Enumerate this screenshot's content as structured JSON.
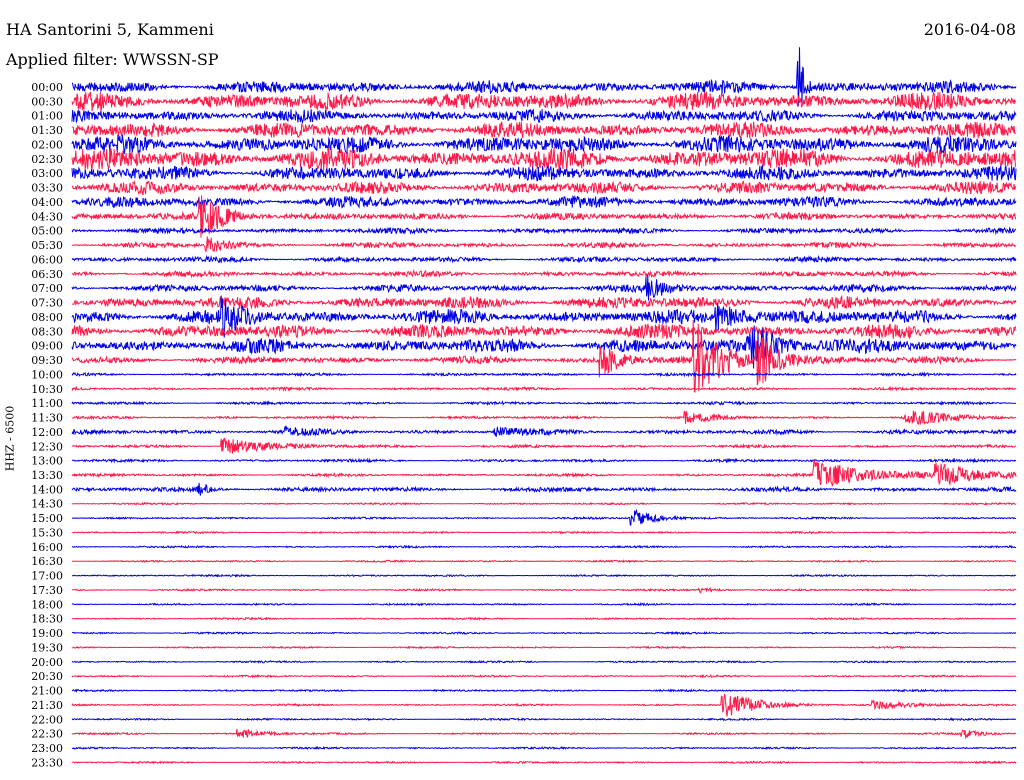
{
  "header": {
    "station": "HA Santorini 5, Kammeni",
    "date": "2016-04-08",
    "filter": "Applied filter: WWSSN-SP",
    "channel": "HHZ - 6500"
  },
  "chart_data": {
    "type": "helicorder",
    "title": "HA Santorini 5, Kammeni",
    "date": "2016-04-08",
    "filter": "WWSSN-SP",
    "channel": "HHZ - 6500",
    "line_minutes": 30,
    "colors": [
      "#0000e6",
      "#ff1a4a"
    ],
    "rows": [
      {
        "label": "00:00",
        "noise": 7
      },
      {
        "label": "00:30",
        "noise": 10
      },
      {
        "label": "01:00",
        "noise": 7
      },
      {
        "label": "01:30",
        "noise": 9
      },
      {
        "label": "02:00",
        "noise": 10
      },
      {
        "label": "02:30",
        "noise": 12
      },
      {
        "label": "03:00",
        "noise": 8
      },
      {
        "label": "03:30",
        "noise": 7
      },
      {
        "label": "04:00",
        "noise": 6
      },
      {
        "label": "04:30",
        "noise": 4
      },
      {
        "label": "05:00",
        "noise": 3
      },
      {
        "label": "05:30",
        "noise": 3
      },
      {
        "label": "06:00",
        "noise": 3
      },
      {
        "label": "06:30",
        "noise": 3
      },
      {
        "label": "07:00",
        "noise": 4
      },
      {
        "label": "07:30",
        "noise": 7
      },
      {
        "label": "08:00",
        "noise": 8
      },
      {
        "label": "08:30",
        "noise": 8
      },
      {
        "label": "09:00",
        "noise": 8
      },
      {
        "label": "09:30",
        "noise": 4
      },
      {
        "label": "10:00",
        "noise": 1.5
      },
      {
        "label": "10:30",
        "noise": 1.5
      },
      {
        "label": "11:00",
        "noise": 1.5
      },
      {
        "label": "11:30",
        "noise": 1.5
      },
      {
        "label": "12:00",
        "noise": 2.5
      },
      {
        "label": "12:30",
        "noise": 1.5
      },
      {
        "label": "13:00",
        "noise": 1.5
      },
      {
        "label": "13:30",
        "noise": 1.5
      },
      {
        "label": "14:00",
        "noise": 2.5
      },
      {
        "label": "14:30",
        "noise": 1
      },
      {
        "label": "15:00",
        "noise": 1
      },
      {
        "label": "15:30",
        "noise": 1
      },
      {
        "label": "16:00",
        "noise": 1
      },
      {
        "label": "16:30",
        "noise": 1
      },
      {
        "label": "17:00",
        "noise": 1
      },
      {
        "label": "17:30",
        "noise": 1
      },
      {
        "label": "18:00",
        "noise": 1
      },
      {
        "label": "18:30",
        "noise": 1
      },
      {
        "label": "19:00",
        "noise": 1
      },
      {
        "label": "19:30",
        "noise": 1
      },
      {
        "label": "20:00",
        "noise": 1
      },
      {
        "label": "20:30",
        "noise": 1
      },
      {
        "label": "21:00",
        "noise": 1
      },
      {
        "label": "21:30",
        "noise": 1
      },
      {
        "label": "22:00",
        "noise": 1
      },
      {
        "label": "22:30",
        "noise": 1
      },
      {
        "label": "23:00",
        "noise": 1
      },
      {
        "label": "23:30",
        "noise": 1
      }
    ],
    "events": [
      {
        "row": 0,
        "minute": 23.1,
        "amplitude": 48,
        "duration_min": 0.3
      },
      {
        "row": 9,
        "minute": 4.1,
        "amplitude": 20,
        "duration_min": 1.5
      },
      {
        "row": 11,
        "minute": 4.3,
        "amplitude": 12,
        "duration_min": 0.7
      },
      {
        "row": 14,
        "minute": 18.3,
        "amplitude": 10,
        "duration_min": 1.2
      },
      {
        "row": 16,
        "minute": 4.8,
        "amplitude": 14,
        "duration_min": 1.2
      },
      {
        "row": 16,
        "minute": 20.5,
        "amplitude": 14,
        "duration_min": 2
      },
      {
        "row": 18,
        "minute": 21.5,
        "amplitude": 24,
        "duration_min": 1.8
      },
      {
        "row": 19,
        "minute": 16.8,
        "amplitude": 18,
        "duration_min": 1.2
      },
      {
        "row": 19,
        "minute": 19.8,
        "amplitude": 40,
        "duration_min": 1.5
      },
      {
        "row": 19,
        "minute": 21.8,
        "amplitude": 28,
        "duration_min": 1.2
      },
      {
        "row": 23,
        "minute": 19.5,
        "amplitude": 6,
        "duration_min": 1.5
      },
      {
        "row": 23,
        "minute": 26.5,
        "amplitude": 8,
        "duration_min": 2.5
      },
      {
        "row": 24,
        "minute": 6.8,
        "amplitude": 4,
        "duration_min": 1.2
      },
      {
        "row": 24,
        "minute": 13.5,
        "amplitude": 4,
        "duration_min": 2
      },
      {
        "row": 25,
        "minute": 4.8,
        "amplitude": 9,
        "duration_min": 2.5
      },
      {
        "row": 27,
        "minute": 23.6,
        "amplitude": 14,
        "duration_min": 3.5
      },
      {
        "row": 27,
        "minute": 27.5,
        "amplitude": 10,
        "duration_min": 2.5
      },
      {
        "row": 28,
        "minute": 4.0,
        "amplitude": 6,
        "duration_min": 0.8
      },
      {
        "row": 30,
        "minute": 17.8,
        "amplitude": 10,
        "duration_min": 1.3
      },
      {
        "row": 35,
        "minute": 20.0,
        "amplitude": 3,
        "duration_min": 1
      },
      {
        "row": 43,
        "minute": 20.7,
        "amplitude": 14,
        "duration_min": 2
      },
      {
        "row": 43,
        "minute": 25.5,
        "amplitude": 4,
        "duration_min": 2
      },
      {
        "row": 45,
        "minute": 5.3,
        "amplitude": 5,
        "duration_min": 1.5
      },
      {
        "row": 45,
        "minute": 28.3,
        "amplitude": 4,
        "duration_min": 1.2
      }
    ]
  }
}
